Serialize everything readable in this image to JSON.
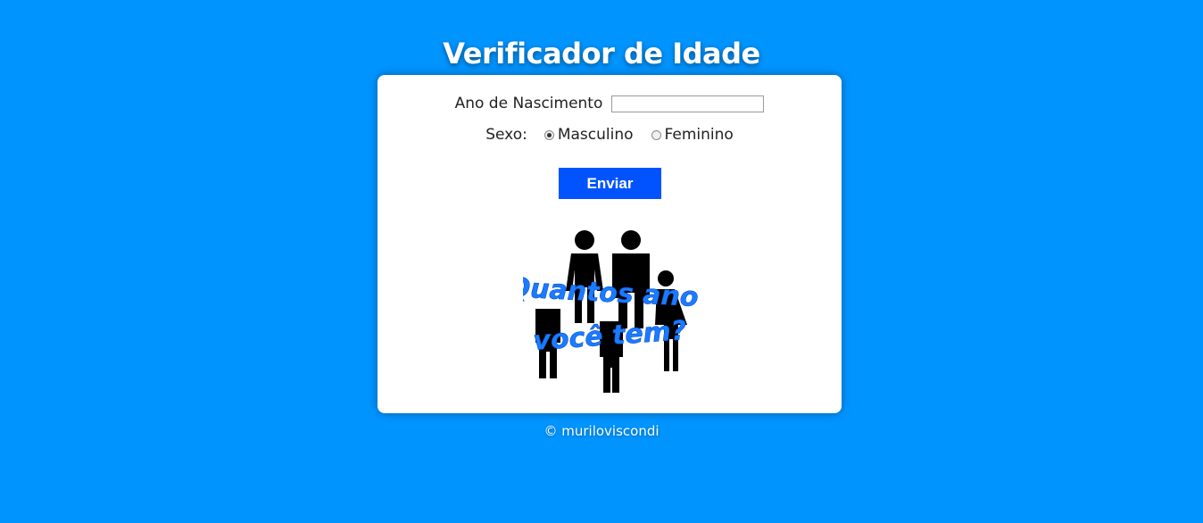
{
  "header": {
    "title": "Verificador de Idade"
  },
  "form": {
    "year_label": "Ano de Nascimento",
    "year_value": "",
    "sex_label": "Sexo:",
    "sex_options": [
      {
        "label": "Masculino",
        "checked": true
      },
      {
        "label": "Feminino",
        "checked": false
      }
    ],
    "submit_label": "Enviar"
  },
  "image": {
    "line1": "Quantos anos",
    "line2": "você tem?"
  },
  "footer": {
    "credit": "© muriloviscondi"
  },
  "colors": {
    "background": "#0094ff",
    "button": "#0053ff",
    "card": "#ffffff"
  }
}
